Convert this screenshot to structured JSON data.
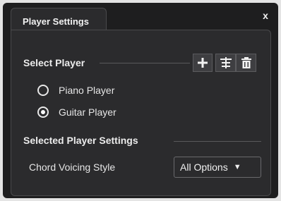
{
  "tab": {
    "title": "Player Settings"
  },
  "window": {
    "close_label": "x"
  },
  "select_player": {
    "heading": "Select Player",
    "buttons": [
      {
        "icon": "plus-icon"
      },
      {
        "icon": "insert-icon"
      },
      {
        "icon": "trash-icon"
      }
    ],
    "options": [
      {
        "label": "Piano Player",
        "checked": false
      },
      {
        "label": "Guitar Player",
        "checked": true
      }
    ]
  },
  "selected_settings": {
    "heading": "Selected Player Settings",
    "chord_voicing_label": "Chord Voicing Style",
    "chord_voicing_value": "All Options",
    "caret": "▼"
  },
  "colors": {
    "background": "#1e1e1f",
    "panel": "#2b2b2d",
    "text": "#e6e6e6"
  }
}
